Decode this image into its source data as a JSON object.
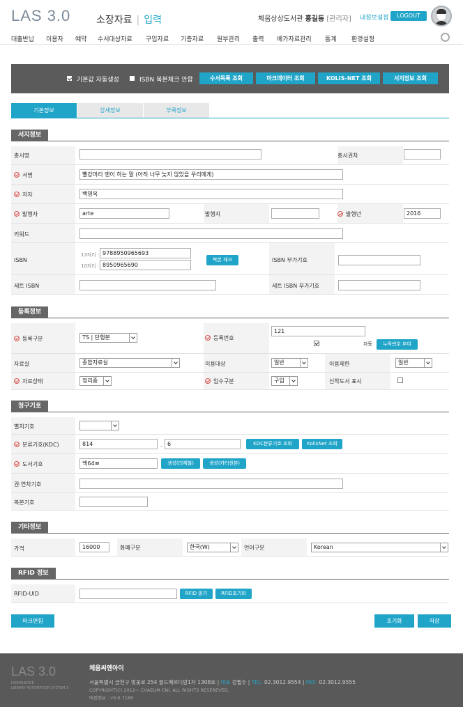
{
  "header": {
    "logo": "LAS 3.0",
    "title": "소장자료",
    "mode": "입력",
    "library": "체움상상도서관",
    "username": "홍길동",
    "role": "[관리자]",
    "my_settings": "내정보설정",
    "logout": "LOGOUT"
  },
  "nav": [
    "대출반납",
    "이용자",
    "예약",
    "수서대상자료",
    "구입자료",
    "기증자료",
    "원부관리",
    "출력",
    "배가자료관리",
    "통계",
    "환경설정"
  ],
  "toolbar": {
    "default_label": "기본값 자동생성",
    "default_checked": true,
    "isbn_label": "ISBN 복본체크 안함",
    "isbn_checked": false,
    "buttons": [
      "수서목록 조회",
      "마크데이터 조회",
      "KOLIS-NET 조회",
      "서지정보 조회"
    ]
  },
  "tabs": [
    "기본정보",
    "상세정보",
    "부록정보"
  ],
  "bib": {
    "section": "서지정보",
    "series_label": "총서명",
    "series_vol_label": "총서권차",
    "title_label": "서명",
    "title_value": "빨강머리 앤이 하는 말 (아직 너무 늦지 않았을 우리에게)",
    "author_label": "저자",
    "author_value": "백영옥",
    "publisher_label": "발행자",
    "publisher_value": "arte",
    "place_label": "발행지",
    "year_label": "발행년",
    "year_value": "2016",
    "keyword_label": "키워드",
    "isbn_label": "ISBN",
    "isbn13_label": "13자리 :",
    "isbn13_value": "9788950965693",
    "isbn10_label": "10자리 :",
    "isbn10_value": "8950965690",
    "dup_check": "복본 체크",
    "isbn_add_label": "ISBN 부가기호",
    "set_isbn_label": "세트 ISBN",
    "set_isbn_add_label": "세트 ISBN 부가기호"
  },
  "reg": {
    "section": "등록정보",
    "type_label": "등록구분",
    "type_value": "TS | 단행본",
    "regno_label": "등록번호",
    "regno_value": "121",
    "auto_label": "자동",
    "auto_checked": true,
    "missing_btn": "누락번호 부여",
    "room_label": "자료실",
    "room_value": "종합자료실",
    "target_label": "이용대상",
    "target_value": "일반",
    "limit_label": "이용제한",
    "limit_value": "일반",
    "status_label": "자료상태",
    "status_value": "정리중",
    "acq_label": "입수구분",
    "acq_value": "구입",
    "new_label": "신착도서 표시",
    "new_checked": false
  },
  "call": {
    "section": "청구기호",
    "separate_label": "별치기호",
    "class_label": "분류기호(KDC)",
    "class_main": "814",
    "class_dot": ".",
    "class_sub": "6",
    "kdc_btn": "KDC분류기호 조회",
    "kolis_btn": "KolisNet 조회",
    "book_label": "도서기호",
    "book_value": "백64ㅃ",
    "gen1": "생성(리재철)",
    "gen2": "생성(카터샌본)",
    "vol_label": "권·연차기호",
    "copy_label": "복본기호"
  },
  "etc": {
    "section": "기타정보",
    "price_label": "가격",
    "price_value": "16000",
    "currency_label": "화폐구분",
    "currency_value": "한국(W)",
    "lang_label": "언어구분",
    "lang_value": "Korean"
  },
  "rfid": {
    "section": "RFID 정보",
    "uid_label": "RFID-UID",
    "read_btn": "RFID 읽기",
    "init_btn": "RFID초기화"
  },
  "actions": {
    "mark": "마크편집",
    "reset": "초기화",
    "save": "저장"
  },
  "footer": {
    "logo": "LAS 3.0",
    "sub1": "KNOWLEDGE",
    "sub2": "LIBRARY AUTOMATION SYSTEM 3",
    "company": "체움씨엔아이",
    "address": "서울특별시 금천구 벚꽃로 254 월드메르디앙1차 1308호",
    "ceo_label": "대표",
    "ceo": "강필수",
    "tel_label": "TEL.",
    "tel": "02.3012.9554",
    "fax_label": "FAX.",
    "fax": "02.3012.9555",
    "copyright": "COPYRIGHT(C) 2012~ CHAEUM CNI. ALL RIGHTS RESEREVED.",
    "version": "버전정보 : v3.0.7188"
  },
  "colors": {
    "accent": "#20a5c9",
    "dark": "#5b5b5b",
    "required": "#d9534f"
  }
}
